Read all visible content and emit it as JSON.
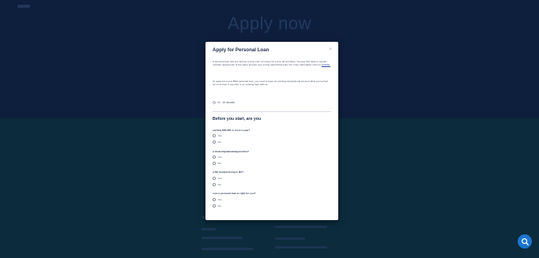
{
  "page": {
    "heading": "Apply now"
  },
  "modal": {
    "title": "Apply for Personal Loan",
    "paragraph_1": "A personal loan lets you borrow a lump sum of money for a one-off purchase. You pay this back in regular monthly repayments of the same amount over a time period that suits. For more information visit our",
    "paragraph_1_link": "website.",
    "paragraph_2": "To apply for a new BNZ personal loan, you need to have an existing transactional account (that you've had for more than 3 months) or an existing loan with us.",
    "time_estimate": "10 - 15 minutes",
    "section_title": "Before you start, are you",
    "questions": [
      {
        "text": "earning $30,000 or more a year?",
        "options": [
          "Yes",
          "No"
        ]
      },
      {
        "text": "a student/graduate/apprentice?",
        "options": [
          "Yes",
          "No"
        ]
      },
      {
        "text": "a NZ resident living in NZ?",
        "options": [
          "Yes",
          "No"
        ]
      },
      {
        "text": "sure a personal loan is right for you?",
        "options": [
          "Yes",
          "No"
        ]
      }
    ]
  },
  "colors": {
    "accent": "#1b74d1",
    "overlay": "#0b1a33"
  },
  "icons": {
    "close": "close-icon",
    "clock": "clock-icon",
    "help": "search-help-icon"
  }
}
